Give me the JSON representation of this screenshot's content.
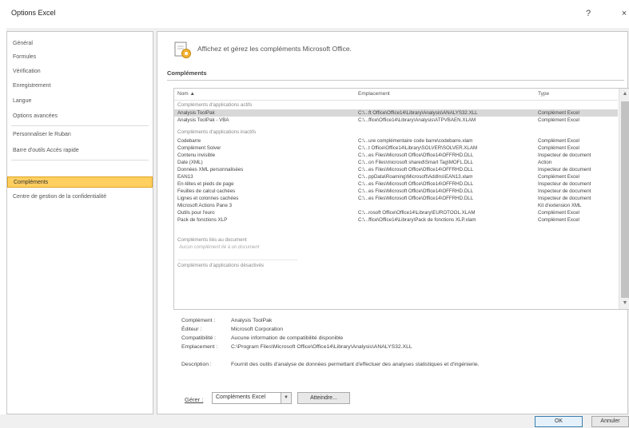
{
  "window": {
    "title": "Options Excel",
    "help_label": "?",
    "close_label": "×"
  },
  "sidebar": {
    "items": [
      {
        "label": "Général"
      },
      {
        "label": "Formules"
      },
      {
        "label": "Vérification"
      },
      {
        "label": "Enregistrement"
      },
      {
        "label": "Langue"
      },
      {
        "label": "Options avancées"
      },
      {
        "label": "Personnaliser le Ruban"
      },
      {
        "label": "Barre d'outils Accès rapide"
      },
      {
        "label": "Compléments",
        "selected": true
      },
      {
        "label": "Centre de gestion de la confidentialité"
      }
    ]
  },
  "main": {
    "header_text": "Affichez et gérez les compléments Microsoft Office.",
    "section_title": "Compléments",
    "columns": {
      "name": "Nom ▲",
      "location": "Emplacement",
      "type": "Type"
    },
    "groups": {
      "active": "Compléments d'applications actifs",
      "inactive": "Compléments d'applications inactifs",
      "document": "Compléments liés au document",
      "document_empty": "Aucun complément lié à un document",
      "disabled": "Compléments d'applications désactivés"
    },
    "active_rows": [
      {
        "name": "Analysis ToolPak",
        "location": "C:\\...ft Office\\Office14\\Library\\Analysis\\ANALYS32.XLL",
        "type": "Complément Excel",
        "selected": true
      },
      {
        "name": "Analysis ToolPak - VBA",
        "location": "C:\\...ffice\\Office14\\Library\\Analysis\\ATPVBAEN.XLAM",
        "type": "Complément Excel"
      }
    ],
    "inactive_rows": [
      {
        "name": "Codebarre",
        "location": "C:\\...ure complémentaire code barre\\codebarre.xlam",
        "type": "Complément Excel"
      },
      {
        "name": "Complément Solver",
        "location": "C:\\...t Office\\Office14\\Library\\SOLVER\\SOLVER.XLAM",
        "type": "Complément Excel"
      },
      {
        "name": "Contenu invisible",
        "location": "C:\\...es Files\\Microsoft Office\\Office14\\OFFRHD.DLL",
        "type": "Inspecteur de document"
      },
      {
        "name": "Date (XML)",
        "location": "C:\\...on Files\\microsoft shared\\Smart Tag\\MOFL.DLL",
        "type": "Action"
      },
      {
        "name": "Données XML personnalisées",
        "location": "C:\\...es Files\\Microsoft Office\\Office14\\OFFRHD.DLL",
        "type": "Inspecteur de document"
      },
      {
        "name": "EAN13",
        "location": "C:\\...ppData\\Roaming\\Microsoft\\AddIns\\EAN13.xlam",
        "type": "Complément Excel"
      },
      {
        "name": "En-têtes et pieds de page",
        "location": "C:\\...es Files\\Microsoft Office\\Office14\\OFFRHD.DLL",
        "type": "Inspecteur de document"
      },
      {
        "name": "Feuilles de calcul cachées",
        "location": "C:\\...es Files\\Microsoft Office\\Office14\\OFFRHD.DLL",
        "type": "Inspecteur de document"
      },
      {
        "name": "Lignes et colonnes cachées",
        "location": "C:\\...es Files\\Microsoft Office\\Office14\\OFFRHD.DLL",
        "type": "Inspecteur de document"
      },
      {
        "name": "Microsoft Actions Pane 3",
        "location": "",
        "type": "Kit d'extension XML"
      },
      {
        "name": "Outils pour l'euro",
        "location": "C:\\...rosoft Office\\Office14\\Library\\EUROTOOL.XLAM",
        "type": "Complément Excel"
      },
      {
        "name": "Pack de fonctions XLP",
        "location": "C:\\...ffice\\Office14\\Library\\Pack de fonctions XLP.xlam",
        "type": "Complément Excel"
      }
    ],
    "details": {
      "addin_label": "Complément :",
      "addin_value": "Analysis ToolPak",
      "publisher_label": "Éditeur :",
      "publisher_value": "Microsoft Corporation",
      "compat_label": "Compatibilité :",
      "compat_value": "Aucune information de compatibilité disponible",
      "location_label": "Emplacement :",
      "location_value": "C:\\Program Files\\Microsoft Office\\Office14\\Library\\Analysis\\ANALYS32.XLL",
      "description_label": "Description :",
      "description_value": "Fournit des outils d'analyse de données permettant d'effectuer des analyses statistiques et d'ingénierie."
    },
    "manage": {
      "label": "Gérer :",
      "value": "Compléments Excel",
      "go_label": "Atteindre..."
    }
  },
  "footer": {
    "ok_label": "OK",
    "cancel_label": "Annuler"
  }
}
